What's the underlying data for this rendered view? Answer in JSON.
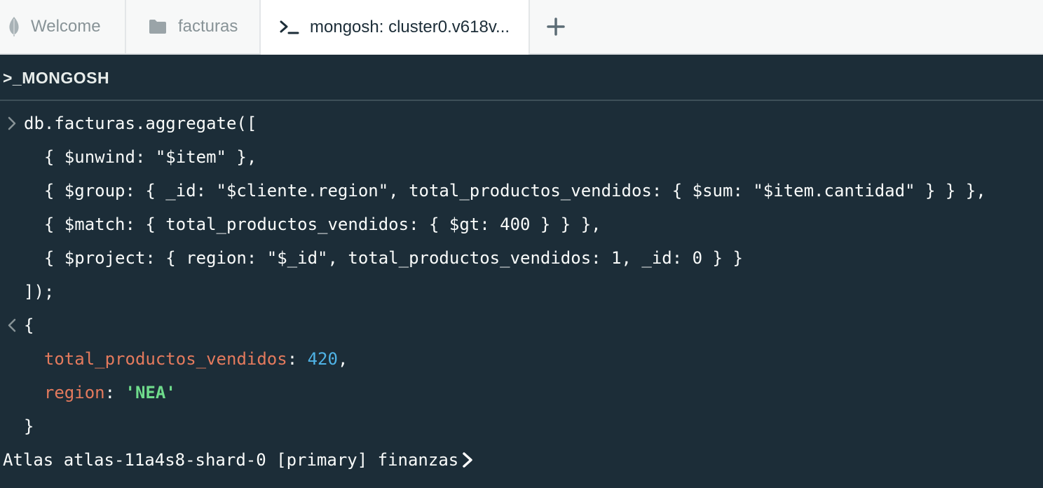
{
  "tabs": [
    {
      "label": "Welcome",
      "icon": "mongodb-leaf-icon"
    },
    {
      "label": "facturas",
      "icon": "folder-icon"
    },
    {
      "label": "mongosh: cluster0.v618v...",
      "icon": "terminal-icon",
      "active": true
    }
  ],
  "add_tab_icon": "plus-icon",
  "shell": {
    "header": ">_MONGOSH",
    "input_lines": [
      "db.facturas.aggregate([",
      "  { $unwind: \"$item\" },",
      "  { $group: { _id: \"$cliente.region\", total_productos_vendidos: { $sum: \"$item.cantidad\" } } },",
      "  { $match: { total_productos_vendidos: { $gt: 400 } } },",
      "  { $project: { region: \"$_id\", total_productos_vendidos: 1, _id: 0 } }",
      "]);"
    ],
    "output": {
      "open": "{",
      "fields": [
        {
          "key": "total_productos_vendidos",
          "sep": ": ",
          "value": "420",
          "trail": ","
        },
        {
          "key": "region",
          "sep": ": ",
          "value": "'NEA'",
          "trail": ""
        }
      ],
      "close": "}"
    },
    "prompt": "Atlas atlas-11a4s8-shard-0 [primary] finanzas"
  },
  "colors": {
    "background": "#1c2d38",
    "tabbar": "#f7f8f8",
    "key": "#e47a5d",
    "number": "#4fb3e6",
    "string": "#6fdc8c",
    "text": "#f9fbfa"
  }
}
